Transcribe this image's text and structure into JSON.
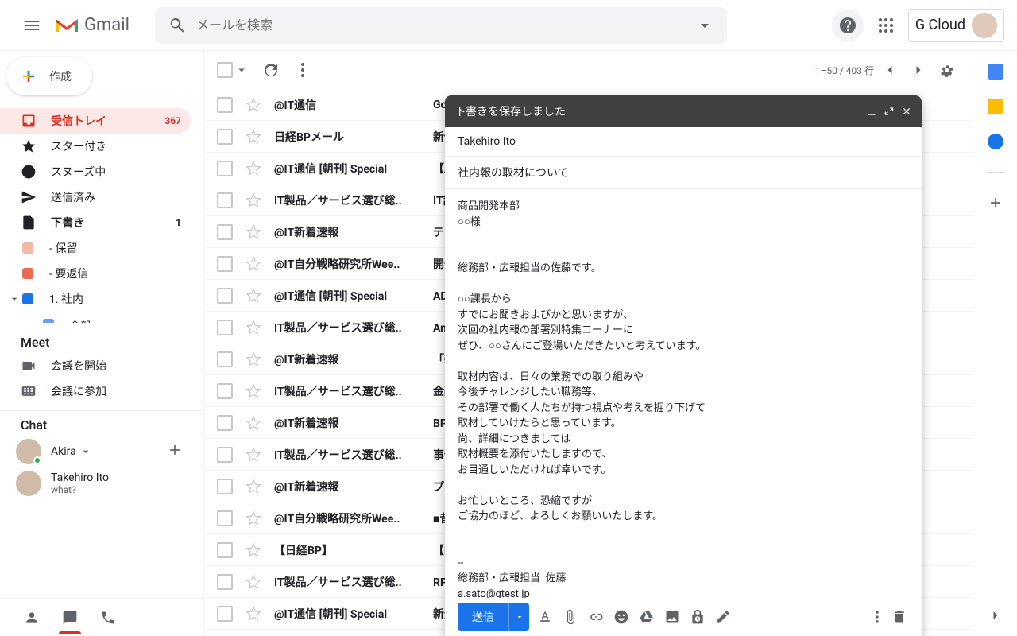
{
  "header": {
    "brand": "Gmail",
    "search_placeholder": "メールを検索",
    "gcloud": "G Cloud"
  },
  "sidebar": {
    "compose": "作成",
    "items": [
      {
        "label": "受信トレイ",
        "count": "367",
        "icon": "inbox",
        "active": true
      },
      {
        "label": "スター付き",
        "icon": "star"
      },
      {
        "label": "スヌーズ中",
        "icon": "clock"
      },
      {
        "label": "送信済み",
        "icon": "send"
      },
      {
        "label": "下書き",
        "count": "1",
        "icon": "draft",
        "bold": true
      },
      {
        "label": "- 保留",
        "icon": "label",
        "color": "#f4b8a6"
      },
      {
        "label": "- 要返信",
        "icon": "label",
        "color": "#ea6a52"
      },
      {
        "label": "1. 社内",
        "icon": "label",
        "color": "#1a73e8",
        "expand": true
      }
    ],
    "sub_item": "全部",
    "meet_title": "Meet",
    "meet_start": "会議を開始",
    "meet_join": "会議に参加",
    "chat_title": "Chat",
    "chat1_name": "Akira",
    "chat2_name": "Takehiro Ito",
    "chat2_sub": "what?"
  },
  "toolbar": {
    "range": "1–50 / 403 行"
  },
  "emails": [
    {
      "sender": "@IT通信",
      "subject": "Google Chrom"
    },
    {
      "sender": "日経BPメール",
      "subject": "新価値創造店"
    },
    {
      "sender": "@IT通信 [朝刊] Special",
      "subject": "【Amazonキ"
    },
    {
      "sender": "IT製品／サービス選び総..",
      "subject": "IT訴訟の専門"
    },
    {
      "sender": "@IT新着速報",
      "subject": "テレワークに"
    },
    {
      "sender": "@IT自分戦略研究所Wee..",
      "subject": "開発者の皆様"
    },
    {
      "sender": "@IT通信 [朝刊] Special",
      "subject": "ADだってク"
    },
    {
      "sender": "IT製品／サービス選び総..",
      "subject": "Amazonギフ"
    },
    {
      "sender": "@IT新着速報",
      "subject": "「新型コロナ"
    },
    {
      "sender": "IT製品／サービス選び総..",
      "subject": "金融業のセキ"
    },
    {
      "sender": "@IT新着速報",
      "subject": "BPFによるト"
    },
    {
      "sender": "IT製品／サービス選び総..",
      "subject": "事例紹介：ク"
    },
    {
      "sender": "@IT新着速報",
      "subject": "プログラムを"
    },
    {
      "sender": "@IT自分戦略研究所Wee..",
      "subject": "■昔は弾道計"
    },
    {
      "sender": "【日経BP】",
      "subject": "【NikkeiBP】"
    },
    {
      "sender": "IT製品／サービス選び総..",
      "subject": "RPAはどんな"
    },
    {
      "sender": "@IT通信 [朝刊] Special",
      "subject": "新登場！Off"
    }
  ],
  "compose": {
    "status": "下書きを保存しました",
    "to": "Takehiro Ito",
    "subject": "社内報の取材について",
    "body": "商品開発本部\n○○様\n\n\n総務部・広報担当の佐藤です。\n\n○○課長から\nすでにお聞きおよびかと思いますが、\n次回の社内報の部署別特集コーナーに\nぜひ、○○さんにご登場いただきたいと考えています。\n\n取材内容は、日々の業務での取り組みや\n今後チャレンジしたい職務等、\nその部署で働く人たちが持つ視点や考えを掘り下げて\n取材していけたらと思っています。\n尚、詳細につきましては\n取材概要を添付いたしますので、\nお目通しいただければ幸いです。\n\nお忙しいところ、恐縮ですが\nご協力のほど、よろしくお願いいたします。\n\n\n--\n総務部・広報担当  佐藤\na.sato@gtest.jp\n|",
    "send": "送信"
  }
}
